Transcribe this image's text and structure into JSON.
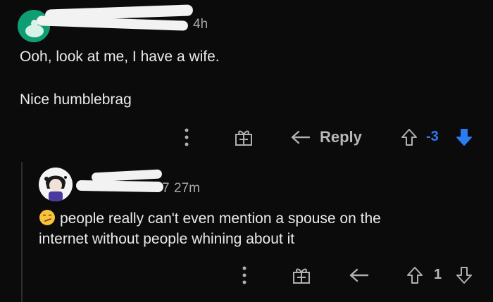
{
  "comment": {
    "time": "4h",
    "body_line1": "Ooh, look at me, I have a wife.",
    "body_line2": "Nice humblebrag",
    "reply_label": "Reply",
    "score": "-3",
    "score_color": "#2a7cf0",
    "accent_avatar": "#0f9e73"
  },
  "reply_comment": {
    "username_fragment": "7",
    "time": "27m",
    "emoji": "smirk-face-icon",
    "body_line1": "people really can't even mention a spouse on the",
    "body_line2": "internet without people whining about it",
    "score": "1"
  },
  "icons": {
    "more": "more-vertical-icon",
    "award": "gift-icon",
    "reply": "reply-arrow-icon",
    "upvote": "upvote-arrow-icon",
    "downvote": "downvote-arrow-icon"
  }
}
